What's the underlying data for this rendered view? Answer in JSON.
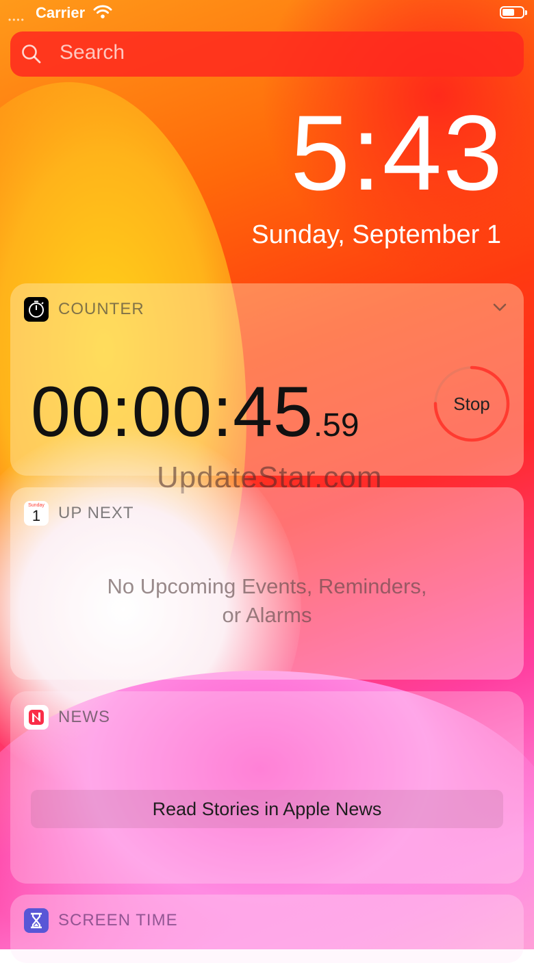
{
  "status_bar": {
    "carrier": "Carrier",
    "signal_dots": "••••"
  },
  "search": {
    "placeholder": "Search"
  },
  "lock": {
    "time": "5:43",
    "date": "Sunday, September 1"
  },
  "counter_widget": {
    "title": "COUNTER",
    "time_main": "00:00:45",
    "time_fraction": ".59",
    "stop_label": "Stop"
  },
  "watermark": "UpdateStar.com",
  "up_next_widget": {
    "title": "UP NEXT",
    "icon_day": "Sunday",
    "icon_date": "1",
    "message_line1": "No Upcoming Events, Reminders,",
    "message_line2": "or Alarms"
  },
  "news_widget": {
    "title": "NEWS",
    "button_label": "Read Stories in Apple News"
  },
  "screen_time_widget": {
    "title": "SCREEN TIME"
  },
  "colors": {
    "stop_ring": "#ff3b30",
    "search_bar": "#ff2a1e",
    "screen_time_icon": "#5856d6"
  }
}
